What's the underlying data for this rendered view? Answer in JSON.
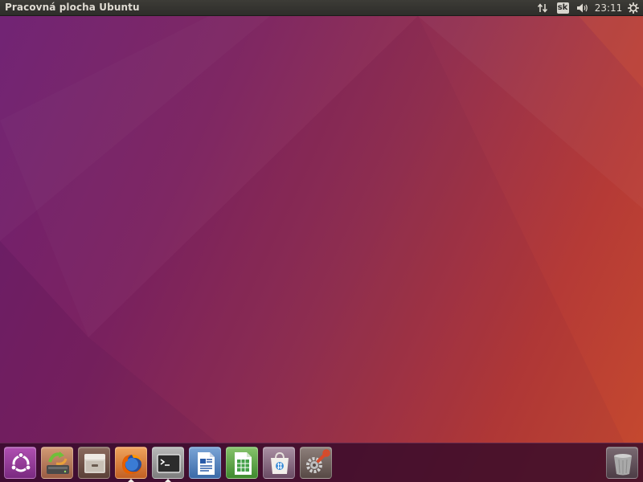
{
  "top_panel": {
    "title": "Pracovná plocha Ubuntu",
    "keyboard_layout": "sk",
    "clock": "23:11",
    "indicators": [
      "network-transfer-icon",
      "keyboard-layout-indicator",
      "volume-icon",
      "clock",
      "session-gear-icon"
    ]
  },
  "launcher": {
    "items": [
      {
        "name": "dash-home-button",
        "icon": "ubuntu-logo-icon",
        "active": false
      },
      {
        "name": "system-backup-button",
        "icon": "backup-restore-icon",
        "active": false
      },
      {
        "name": "files-button",
        "icon": "file-cabinet-icon",
        "active": false
      },
      {
        "name": "firefox-button",
        "icon": "firefox-icon",
        "active": true
      },
      {
        "name": "terminal-button",
        "icon": "terminal-icon",
        "active": true
      },
      {
        "name": "libreoffice-writer-button",
        "icon": "writer-document-icon",
        "active": false
      },
      {
        "name": "libreoffice-calc-button",
        "icon": "calc-spreadsheet-icon",
        "active": false
      },
      {
        "name": "software-center-button",
        "icon": "shopping-bag-icon",
        "active": false
      },
      {
        "name": "system-settings-button",
        "icon": "settings-wrench-gear-icon",
        "active": false
      },
      {
        "name": "trash-button",
        "icon": "trash-can-icon",
        "active": false
      }
    ]
  },
  "colors": {
    "panel": "#2e2d2a",
    "panel_text": "#dfdbd2",
    "wallpaper_left": "#6e1f72",
    "wallpaper_right": "#c64a2e",
    "launcher_bg": "#340a2a",
    "ubuntu_purple": "#8b2d8f",
    "firefox_orange": "#e66000"
  }
}
